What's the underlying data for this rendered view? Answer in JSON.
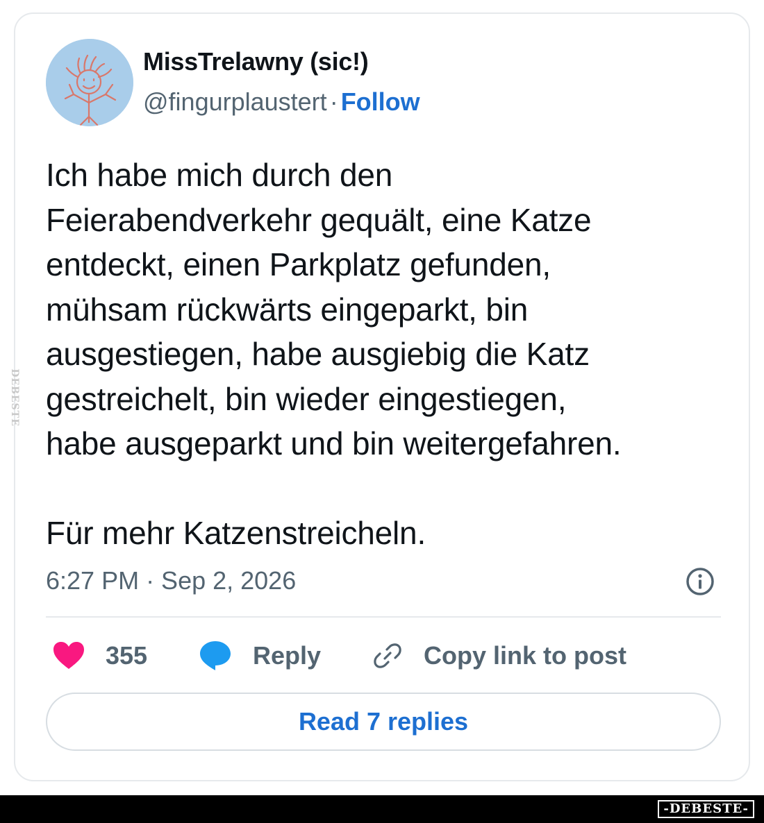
{
  "tweet": {
    "author": {
      "display_name": "MissTrelawny (sic!)",
      "handle": "@fingurplaustert",
      "separator": "·",
      "follow_label": "Follow"
    },
    "text": "Ich habe mich durch den\nFeierabendverkehr gequält, eine Katze\nentdeckt, einen Parkplatz gefunden,\nmühsam rückwärts eingeparkt, bin\nausgestiegen, habe ausgiebig die Katz\ngestreichelt, bin wieder eingestiegen,\nhabe ausgeparkt und bin weitergefahren.\n\nFür mehr Katzenstreicheln.",
    "timestamp": "6:27 PM · Sep 2, 2026",
    "actions": {
      "like_count": "355",
      "reply_label": "Reply",
      "copy_link_label": "Copy link to post"
    },
    "read_replies_label": "Read 7 replies"
  },
  "watermark": {
    "side_text": "DEBESTE",
    "bottom_text": "-DEBESTE-"
  },
  "colors": {
    "follow_blue": "#1d6fd1",
    "like_pink": "#f91880",
    "reply_blue": "#1d9bf0",
    "muted_gray": "#536471"
  }
}
